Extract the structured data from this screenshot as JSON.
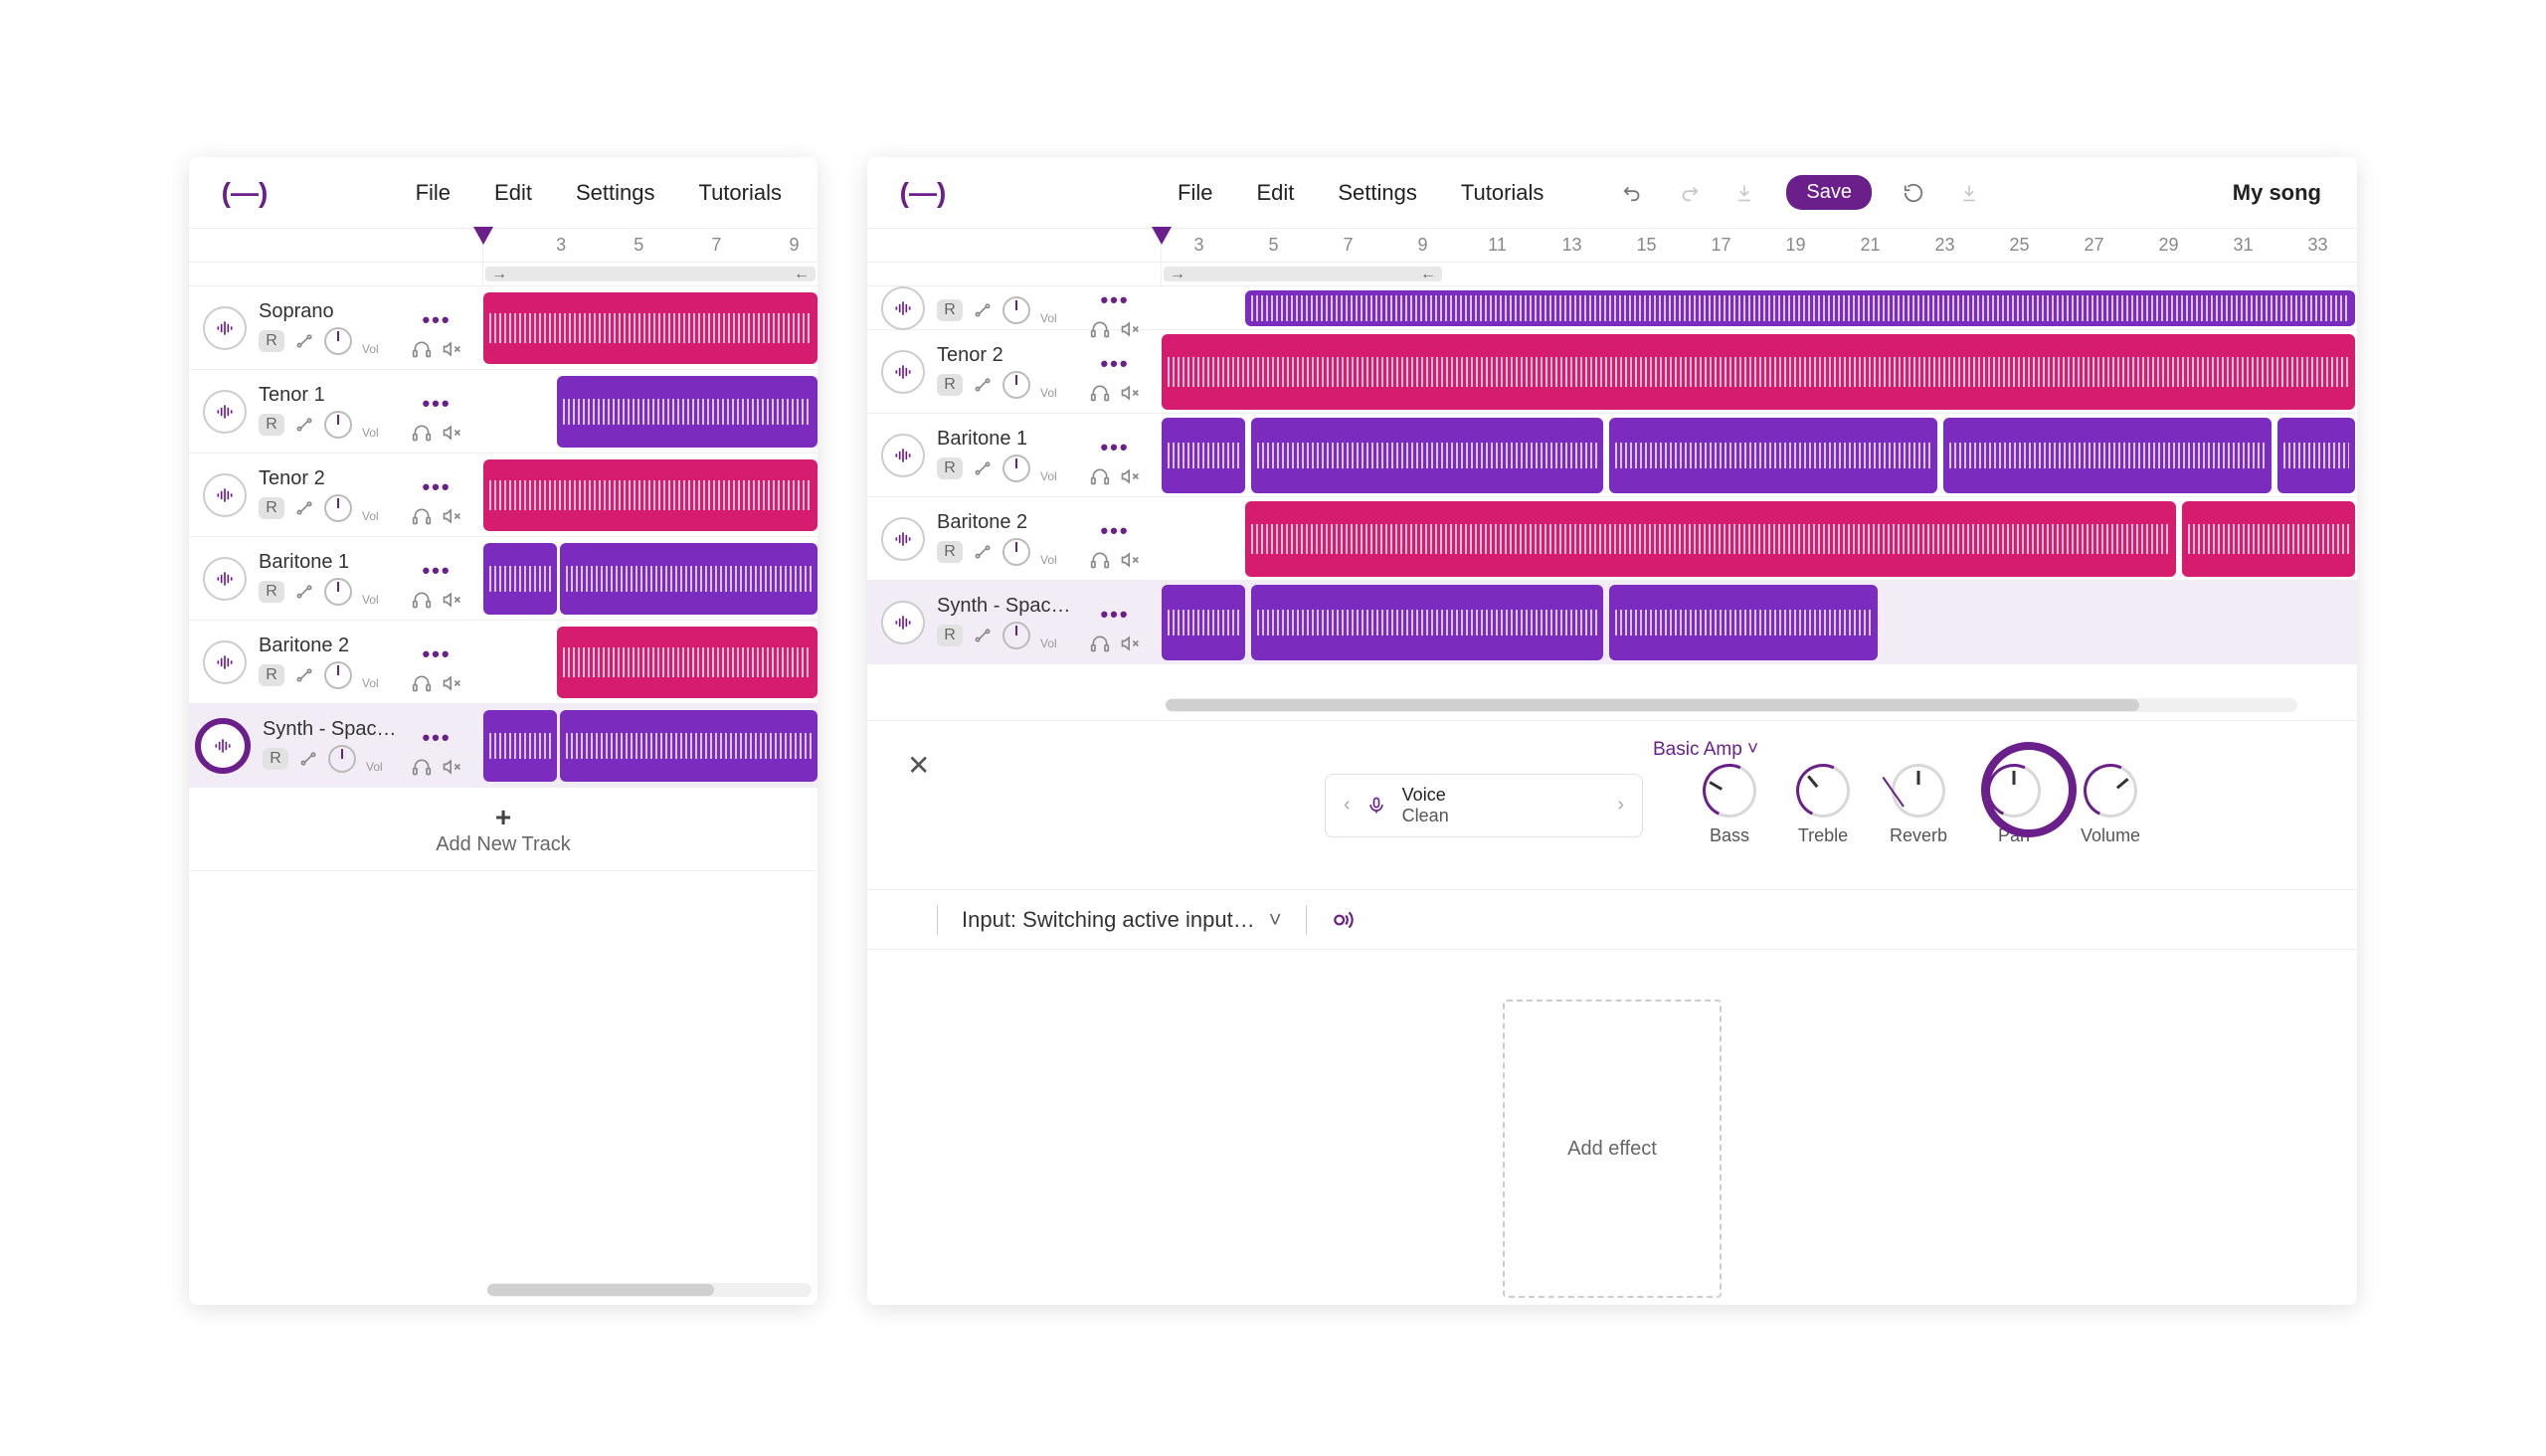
{
  "left": {
    "menu": [
      "File",
      "Edit",
      "Settings",
      "Tutorials"
    ],
    "ruler_ticks": [
      3,
      5,
      7,
      9
    ],
    "tracks": [
      {
        "name": "Soprano",
        "rec": "R"
      },
      {
        "name": "Tenor 1",
        "rec": "R"
      },
      {
        "name": "Tenor 2",
        "rec": "R"
      },
      {
        "name": "Baritone 1",
        "rec": "R"
      },
      {
        "name": "Baritone 2",
        "rec": "R"
      },
      {
        "name": "Synth - Space A…",
        "rec": "R"
      }
    ],
    "add_track": "Add New Track",
    "vol": "Vol"
  },
  "right": {
    "menu": [
      "File",
      "Edit",
      "Settings",
      "Tutorials"
    ],
    "save": "Save",
    "song_title": "My song",
    "ruler_ticks": [
      3,
      5,
      7,
      9,
      11,
      13,
      15,
      17,
      19,
      21,
      23,
      25,
      27,
      29,
      31,
      33
    ],
    "tracks": [
      {
        "name": "",
        "rec": "R"
      },
      {
        "name": "Tenor 2",
        "rec": "R"
      },
      {
        "name": "Baritone 1",
        "rec": "R"
      },
      {
        "name": "Baritone 2",
        "rec": "R"
      },
      {
        "name": "Synth - Space A…",
        "rec": "R"
      }
    ],
    "vol": "Vol",
    "amp_name": "Basic Amp",
    "preset": {
      "top": "Voice",
      "bottom": "Clean"
    },
    "knobs": [
      "Bass",
      "Treble",
      "Reverb",
      "Pan",
      "Volume"
    ],
    "input_label": "Input: Switching active input…",
    "add_effect": "Add effect"
  }
}
